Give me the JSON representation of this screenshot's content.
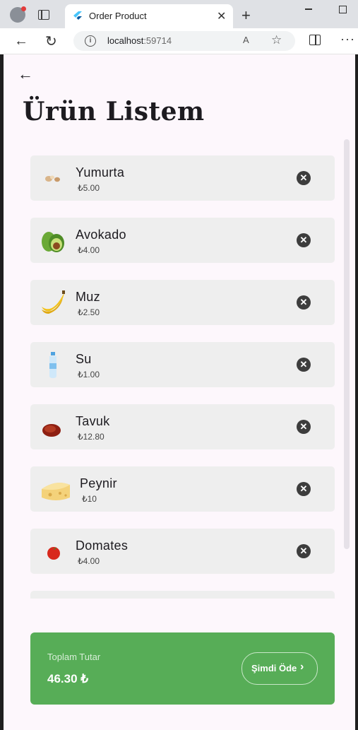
{
  "browser": {
    "tab_title": "Order Product",
    "tab_close": "✕",
    "new_tab": "+",
    "back": "←",
    "reload": "↻",
    "url_host": "localhost",
    "url_port": ":59714",
    "read_aloud": "A",
    "favorite": "☆",
    "more": "···"
  },
  "app": {
    "back": "←",
    "title": "Ürün Listem"
  },
  "items": [
    {
      "name": "Yumurta",
      "price": "₺5.00"
    },
    {
      "name": "Avokado",
      "price": "₺4.00"
    },
    {
      "name": "Muz",
      "price": "₺2.50"
    },
    {
      "name": "Su",
      "price": "₺1.00"
    },
    {
      "name": "Tavuk",
      "price": "₺12.80"
    },
    {
      "name": "Peynir",
      "price": "₺10"
    },
    {
      "name": "Domates",
      "price": "₺4.00"
    }
  ],
  "remove_glyph": "✕",
  "summary": {
    "label": "Toplam Tutar",
    "value": "46.30 ₺",
    "pay_label": "Şimdi Öde",
    "pay_chevron": "›"
  },
  "colors": {
    "accent": "#57ad57",
    "background": "#fdf7fc",
    "card": "#eeeeee"
  }
}
